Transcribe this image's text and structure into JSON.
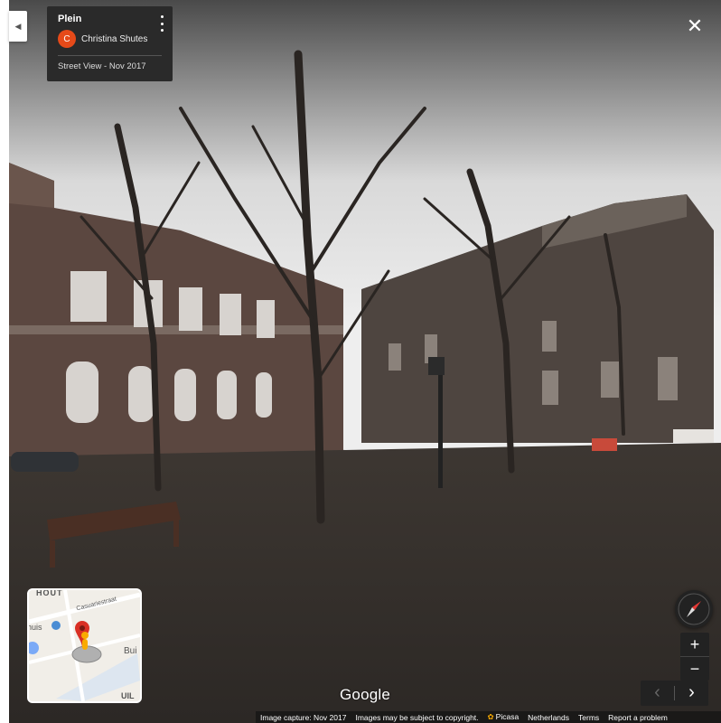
{
  "location": {
    "title": "Plein",
    "author_initial": "C",
    "author": "Christina Shutes",
    "capture_label": "Street View - Nov 2017"
  },
  "minimap": {
    "labels": [
      "HOUT",
      "Casuariestraat",
      "huis",
      "Bui",
      "UIL"
    ]
  },
  "controls": {
    "zoom_in": "+",
    "zoom_out": "−",
    "prev": "‹",
    "next": "›",
    "close": "✕"
  },
  "branding": {
    "logo": "Google"
  },
  "footer": {
    "capture": "Image capture: Nov 2017",
    "copyright": "Images may be subject to copyright.",
    "picasa": "Picasa",
    "country": "Netherlands",
    "terms": "Terms",
    "report": "Report a problem"
  },
  "colors": {
    "avatar": "#e64a19",
    "card_bg": "#2a2a2a",
    "pin": "#d93025",
    "pegman": "#f9ab00"
  }
}
